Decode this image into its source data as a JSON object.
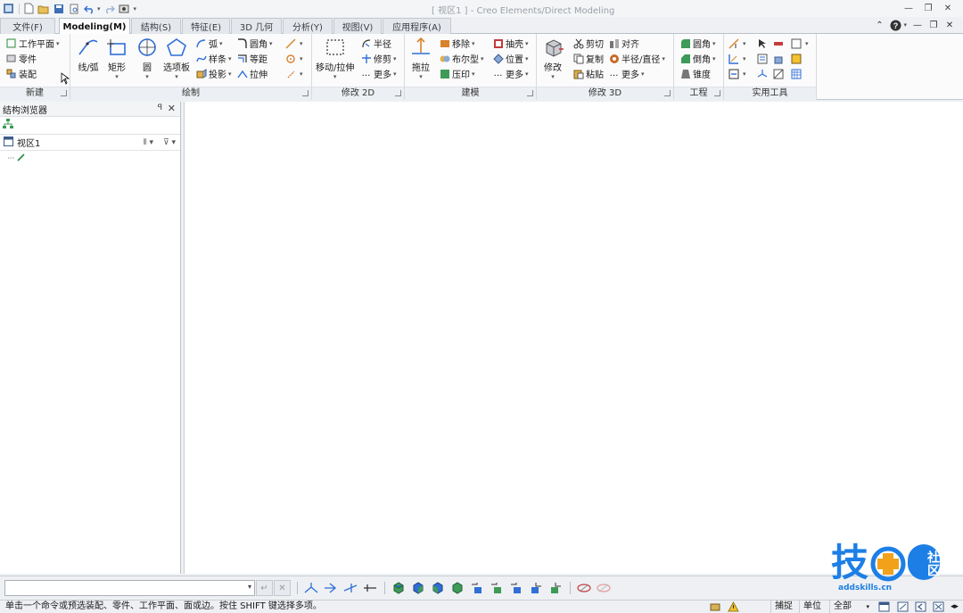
{
  "title_bar": {
    "title": "[ 视区1 ] - Creo Elements/Direct Modeling"
  },
  "tabs": [
    "文件(F)",
    "Modeling(M)",
    "结构(S)",
    "特征(E)",
    "3D 几何",
    "分析(Y)",
    "视图(V)",
    "应用程序(A)"
  ],
  "groups": {
    "new": {
      "label": "新建",
      "items": [
        "工作平面",
        "零件",
        "装配"
      ]
    },
    "draw": {
      "label": "绘制",
      "large": [
        "线/弧",
        "矩形",
        "圆",
        "选项板"
      ],
      "small": [
        "弧",
        "样条",
        "投影",
        "圆角",
        "等距",
        "拉伸"
      ]
    },
    "modify2d": {
      "label": "修改 2D",
      "large": "移动/拉伸",
      "small": [
        "半径",
        "修剪",
        "更多"
      ]
    },
    "build": {
      "label": "建模",
      "large": "拖拉",
      "small": [
        "移除",
        "布尔型",
        "压印",
        "抽壳",
        "位置",
        "更多"
      ]
    },
    "modify3d": {
      "label": "修改 3D",
      "large": "修改",
      "small": [
        "剪切",
        "复制",
        "粘贴",
        "对齐",
        "半径/直径",
        "更多"
      ]
    },
    "engineering": {
      "label": "工程",
      "small": [
        "圆角",
        "倒角",
        "锥度"
      ]
    },
    "utilities": {
      "label": "实用工具"
    }
  },
  "browser": {
    "title": "结构浏览器",
    "pin": "ꟼ",
    "close": "✕",
    "root": "视区1"
  },
  "cmd": {
    "placeholder": ""
  },
  "status": {
    "message": "单击一个命令或预选装配、零件、工作平面、面或边。按住 SHIFT 键选择多项。",
    "snap": "捕捉",
    "units": "单位",
    "filter": "全部"
  },
  "watermark": {
    "brand": "技",
    "sub": "社区",
    "url": "addskills.cn"
  },
  "colors": {
    "accent": "#2f6fd6",
    "ribbon_bg": "#fbfbfc"
  }
}
